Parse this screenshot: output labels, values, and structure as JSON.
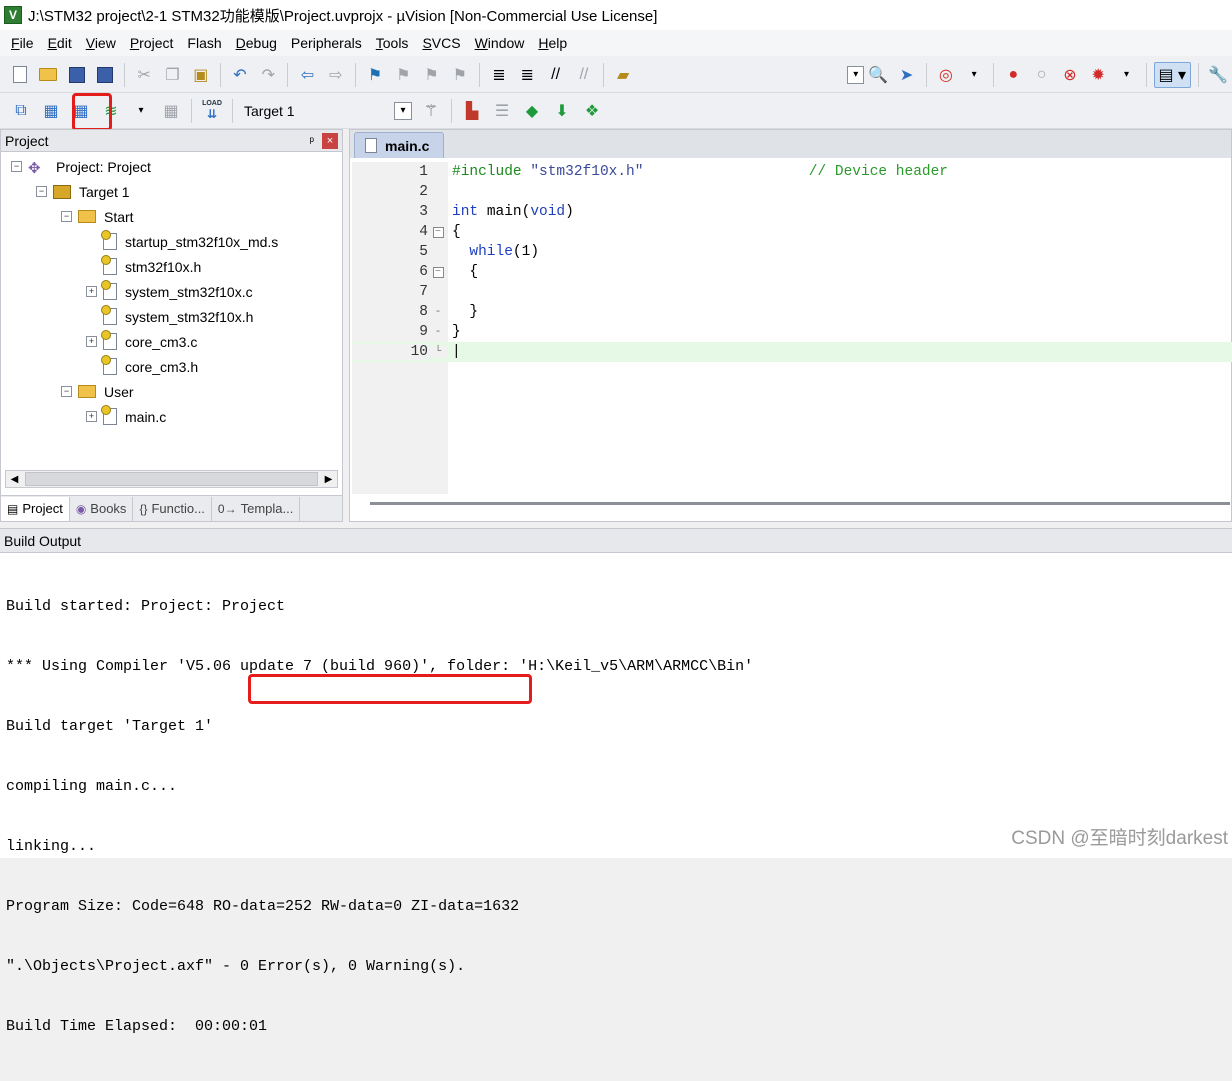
{
  "window": {
    "title": "J:\\STM32 project\\2-1 STM32功能模版\\Project.uvprojx - µVision  [Non-Commercial Use License]",
    "app_icon_letter": "V"
  },
  "menu": [
    {
      "ul": "F",
      "rest": "ile"
    },
    {
      "ul": "E",
      "rest": "dit"
    },
    {
      "ul": "V",
      "rest": "iew"
    },
    {
      "ul": "P",
      "rest": "roject"
    },
    {
      "ul": "",
      "rest": "Flash"
    },
    {
      "ul": "D",
      "rest": "ebug"
    },
    {
      "ul": "",
      "rest": "Peripherals"
    },
    {
      "ul": "T",
      "rest": "ools"
    },
    {
      "ul": "S",
      "rest": "VCS"
    },
    {
      "ul": "W",
      "rest": "indow"
    },
    {
      "ul": "H",
      "rest": "elp"
    }
  ],
  "toolbar2": {
    "target_name": "Target 1",
    "load_label": "LOAD"
  },
  "project_panel": {
    "title": "Project",
    "pin_glyph": "ᵖ",
    "close_glyph": "×",
    "tree": [
      {
        "label": "Project: Project",
        "level": 0,
        "kind": "project",
        "expander": "−"
      },
      {
        "label": "Target 1",
        "level": 1,
        "kind": "target",
        "expander": "−"
      },
      {
        "label": "Start",
        "level": 2,
        "kind": "folder",
        "expander": "−"
      },
      {
        "label": "startup_stm32f10x_md.s",
        "level": 3,
        "kind": "file",
        "expander": ""
      },
      {
        "label": "stm32f10x.h",
        "level": 3,
        "kind": "file",
        "expander": ""
      },
      {
        "label": "system_stm32f10x.c",
        "level": 3,
        "kind": "file",
        "expander": "+"
      },
      {
        "label": "system_stm32f10x.h",
        "level": 3,
        "kind": "file",
        "expander": ""
      },
      {
        "label": "core_cm3.c",
        "level": 3,
        "kind": "file",
        "expander": "+"
      },
      {
        "label": "core_cm3.h",
        "level": 3,
        "kind": "file",
        "expander": ""
      },
      {
        "label": "User",
        "level": 2,
        "kind": "folder",
        "expander": "−"
      },
      {
        "label": "main.c",
        "level": 3,
        "kind": "file",
        "expander": "+"
      }
    ],
    "tabs": [
      {
        "label": "Project",
        "icon": "▤",
        "active": true
      },
      {
        "label": "Books",
        "icon": "◉",
        "active": false
      },
      {
        "label": "Functio...",
        "icon": "{}",
        "active": false
      },
      {
        "label": "Templa...",
        "icon": "0→",
        "active": false
      }
    ]
  },
  "editor": {
    "tab_label": "main.c",
    "lines": [
      {
        "n": "1",
        "fold": ""
      },
      {
        "n": "2",
        "fold": ""
      },
      {
        "n": "3",
        "fold": ""
      },
      {
        "n": "4",
        "fold": "box"
      },
      {
        "n": "5",
        "fold": ""
      },
      {
        "n": "6",
        "fold": "box"
      },
      {
        "n": "7",
        "fold": ""
      },
      {
        "n": "8",
        "fold": "dash"
      },
      {
        "n": "9",
        "fold": ""
      },
      {
        "n": "10",
        "fold": "end"
      }
    ],
    "code": {
      "l1_kw": "#include",
      "l1_str": "\"stm32f10x.h\"",
      "l1_cmt": "// Device header",
      "l3_type": "int",
      "l3_name": "main",
      "l3_arg": "void",
      "l4": "{",
      "l5_kw": "while",
      "l5_arg": "1",
      "l6": "{",
      "l8": "}",
      "l9": "}"
    }
  },
  "build_output": {
    "title": "Build Output",
    "lines": [
      "Build started: Project: Project",
      "*** Using Compiler 'V5.06 update 7 (build 960)', folder: 'H:\\Keil_v5\\ARM\\ARMCC\\Bin'",
      "Build target 'Target 1'",
      "compiling main.c...",
      "linking...",
      "Program Size: Code=648 RO-data=252 RW-data=0 ZI-data=1632",
      "\".\\Objects\\Project.axf\" - 0 Error(s), 0 Warning(s).",
      "Build Time Elapsed:  00:00:01"
    ]
  },
  "watermark": "CSDN @至暗时刻darkest",
  "colors": {
    "highlight_box": "#e51c1c",
    "active_line": "#e6f8e6",
    "keyword_green": "#1b8a1b",
    "keyword_blue": "#1e3fbf"
  }
}
